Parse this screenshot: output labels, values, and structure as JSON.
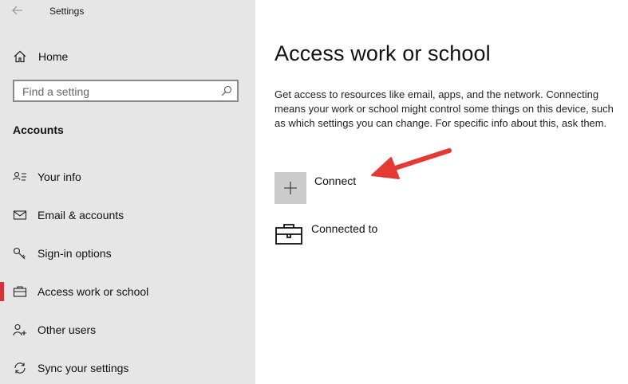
{
  "window": {
    "title": "Settings"
  },
  "sidebar": {
    "home_label": "Home",
    "search_placeholder": "Find a setting",
    "section_title": "Accounts",
    "items": [
      {
        "label": "Your info",
        "icon": "person-card-icon",
        "selected": false
      },
      {
        "label": "Email & accounts",
        "icon": "mail-icon",
        "selected": false
      },
      {
        "label": "Sign-in options",
        "icon": "key-icon",
        "selected": false
      },
      {
        "label": "Access work or school",
        "icon": "briefcase-icon",
        "selected": true
      },
      {
        "label": "Other users",
        "icon": "person-add-icon",
        "selected": false
      },
      {
        "label": "Sync your settings",
        "icon": "sync-icon",
        "selected": false
      }
    ]
  },
  "main": {
    "title": "Access work or school",
    "description": "Get access to resources like email, apps, and the network. Connecting means your work or school might control some things on this device, such as which settings you can change. For specific info about this, ask them.",
    "connect_label": "Connect",
    "connected_label": "Connected to"
  },
  "colors": {
    "sidebar_bg": "#e6e6e6",
    "accent_selected": "#d13438",
    "annotation_arrow": "#e53935",
    "tile_bg": "#cccccc"
  }
}
